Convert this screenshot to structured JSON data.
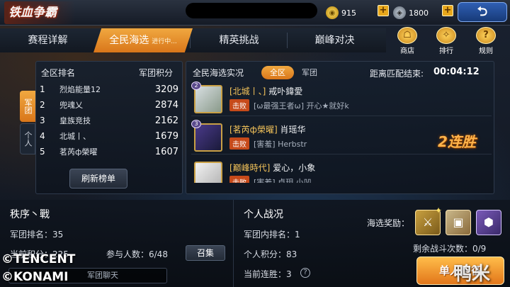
{
  "top": {
    "logo": "铁血争霸",
    "gold": "915",
    "silver": "1800",
    "back_icon": "back-arrow-icon"
  },
  "tabs": [
    {
      "label": "赛程详解"
    },
    {
      "label": "全民海选",
      "sub": "进行中..."
    },
    {
      "label": "精英挑战"
    },
    {
      "label": "巅峰对决"
    }
  ],
  "side_buttons": {
    "shop": "商店",
    "rank": "排行",
    "rules": "规则"
  },
  "ranking": {
    "title": "全区排名",
    "score_header": "军团积分",
    "side_tab_legion": "军团",
    "side_tab_person": "个人",
    "rows": [
      {
        "rank": "1",
        "name": "烈焰能量12",
        "score": "3209"
      },
      {
        "rank": "2",
        "name": "兜魂乂",
        "score": "2874"
      },
      {
        "rank": "3",
        "name": "皇族竞技",
        "score": "2162"
      },
      {
        "rank": "4",
        "name": "北城丨、",
        "score": "1679"
      },
      {
        "rank": "5",
        "name": "茗芮ф榮曜",
        "score": "1607"
      }
    ],
    "refresh": "刷新榜单"
  },
  "live": {
    "title": "全民海选实况",
    "filter_all": "全区",
    "filter_legion": "军团",
    "countdown_label": "距离匹配结束:",
    "countdown": "00:04:12",
    "streak": "2连胜",
    "feed": [
      {
        "badge": "2",
        "guild": "[北城丨、]",
        "player": "戒卟鍏愛",
        "kill": "击败",
        "victim": "[ω最强王者ω]  开心★就好k"
      },
      {
        "badge": "3",
        "guild": "[茗芮ф榮曜]",
        "player": "肖瑶华",
        "kill": "击败",
        "victim": "[害羞]  Herbstr"
      },
      {
        "badge": "",
        "guild": "[巅峰時代]",
        "player": "爱心，小象",
        "kill": "击败",
        "victim": "[害羞]  卓玥 小凹"
      }
    ]
  },
  "legion": {
    "name": "秩序丶戰",
    "rank_label": "军团排名：35",
    "score_label": "当前积分：225",
    "participants": "参与人数：6/48",
    "summon": "召集",
    "chat": "军团聊天"
  },
  "personal": {
    "title": "个人战况",
    "rank": "军团内排名：1",
    "score": "个人积分：83",
    "streak": "当前连胜：3",
    "reward_label": "海选奖励：",
    "remaining": "剩余战斗次数：0/9",
    "start": "单人出征"
  },
  "watermark": {
    "line1": "©TENCENT",
    "line2": "©KONAMI",
    "right": "鸭米"
  }
}
